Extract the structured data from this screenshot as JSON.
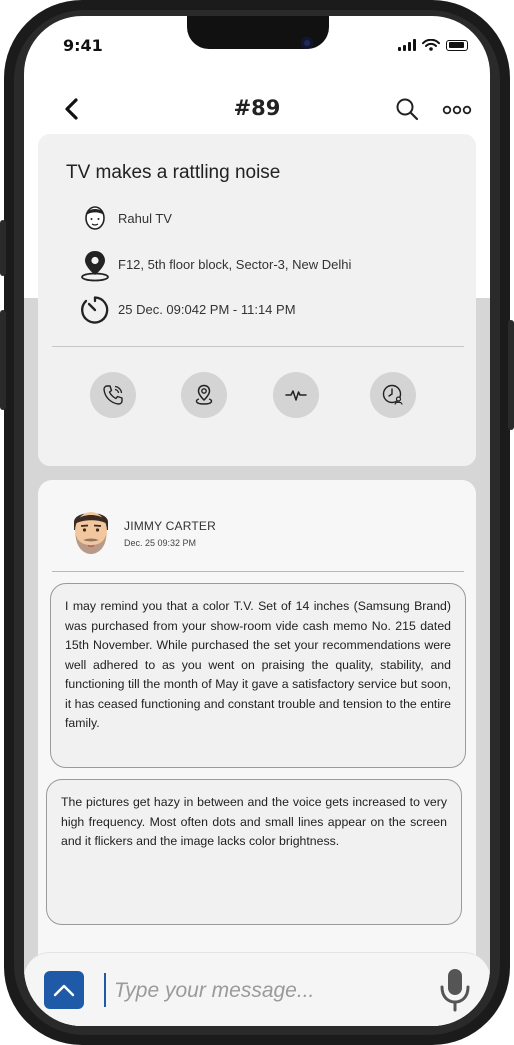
{
  "status": {
    "time": "9:41"
  },
  "header": {
    "title": "#89"
  },
  "ticket": {
    "title": "TV makes a rattling noise",
    "customer": "Rahul TV",
    "address": "F12, 5th floor block, Sector-3, New Delhi",
    "time_range": "25 Dec. 09:042 PM - 11:14 PM",
    "actions": [
      "call-icon",
      "location-icon",
      "activity-icon",
      "schedule-icon"
    ]
  },
  "comment": {
    "author": "JIMMY CARTER",
    "date": "Dec. 25 09:32 PM",
    "messages": [
      "I may remind you that a color T.V. Set of 14 inches (Samsung Brand) was purchased from your show-room vide cash memo No. 215 dated 15th November. While purchased the set your recommendations were well adhered to as you went on praising the quality, stability, and functioning till the month of May it gave a satisfactory service but soon, it has ceased functioning and constant trouble and tension to the entire family.",
      "The pictures get hazy in between and the voice gets increased to very high frequency. Most often dots and small lines appear on the screen and it flickers and the image lacks color brightness."
    ]
  },
  "composer": {
    "placeholder": "Type your message..."
  },
  "colors": {
    "accent": "#1e5aa8",
    "card": "#f1f1f1",
    "band": "#d6d6d6"
  }
}
